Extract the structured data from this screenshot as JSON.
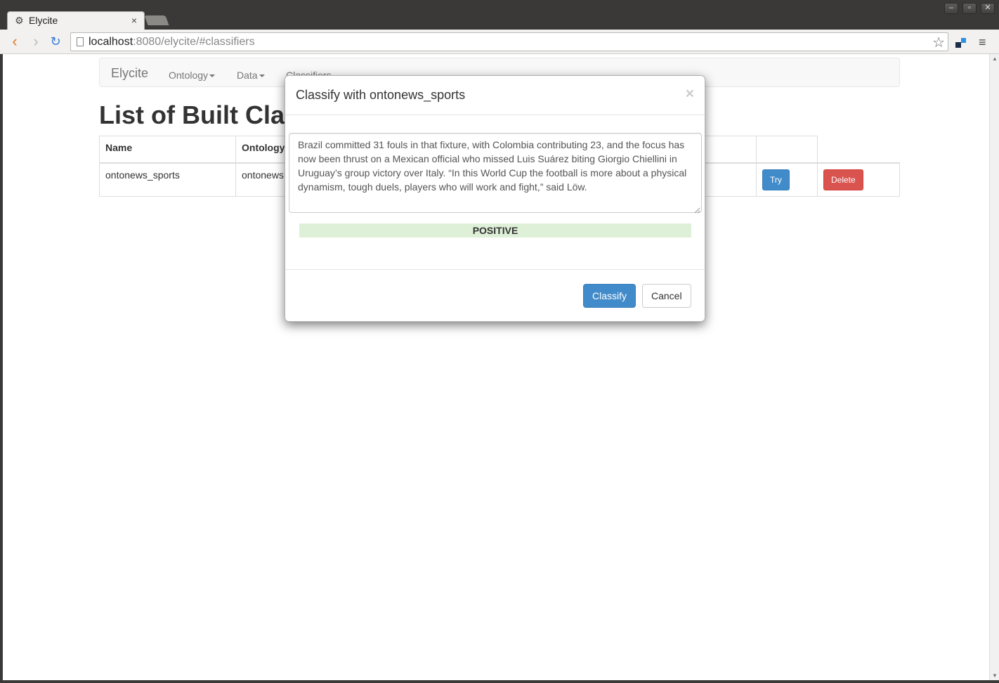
{
  "browser": {
    "tab_title": "Elycite",
    "tab_close": "×",
    "url_host": "localhost",
    "url_path": ":8080/elycite/#classifiers"
  },
  "navbar": {
    "brand": "Elycite",
    "items": [
      {
        "label": "Ontology"
      },
      {
        "label": "Data"
      },
      {
        "label": "Classifiers"
      }
    ]
  },
  "page": {
    "title": "List of Built Classifiers"
  },
  "table": {
    "headers": [
      "Name",
      "Ontology"
    ],
    "rows": [
      {
        "name": "ontonews_sports",
        "ontology": "ontonews",
        "try_label": "Try",
        "delete_label": "Delete"
      }
    ]
  },
  "modal": {
    "title": "Classify with ontonews_sports",
    "close": "×",
    "text": "Brazil committed 31 fouls in that fixture, with Colombia contributing 23, and the focus has now been thrust on a Mexican official who missed Luis Suárez biting Giorgio Chiellini in Uruguay’s group victory over Italy. “In this World Cup the football is more about a physical dynamism, tough duels, players who will work and fight,” said Löw.",
    "result": "POSITIVE",
    "classify_label": "Classify",
    "cancel_label": "Cancel"
  },
  "colors": {
    "primary": "#428bca",
    "danger": "#d9534f",
    "success_bg": "#dff0d8"
  }
}
